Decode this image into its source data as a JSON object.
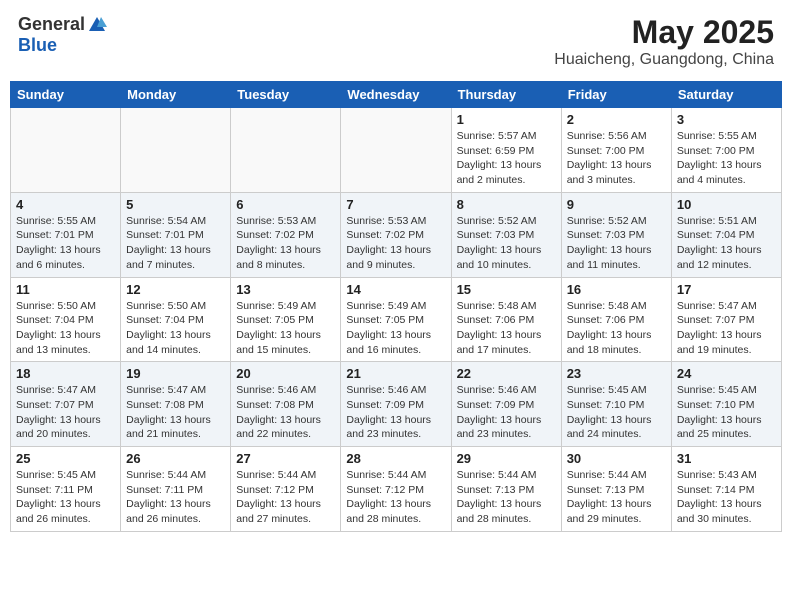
{
  "header": {
    "logo_general": "General",
    "logo_blue": "Blue",
    "month_title": "May 2025",
    "location": "Huaicheng, Guangdong, China"
  },
  "calendar": {
    "days_of_week": [
      "Sunday",
      "Monday",
      "Tuesday",
      "Wednesday",
      "Thursday",
      "Friday",
      "Saturday"
    ],
    "weeks": [
      [
        {
          "day": "",
          "content": ""
        },
        {
          "day": "",
          "content": ""
        },
        {
          "day": "",
          "content": ""
        },
        {
          "day": "",
          "content": ""
        },
        {
          "day": "1",
          "content": "Sunrise: 5:57 AM\nSunset: 6:59 PM\nDaylight: 13 hours and 2 minutes."
        },
        {
          "day": "2",
          "content": "Sunrise: 5:56 AM\nSunset: 7:00 PM\nDaylight: 13 hours and 3 minutes."
        },
        {
          "day": "3",
          "content": "Sunrise: 5:55 AM\nSunset: 7:00 PM\nDaylight: 13 hours and 4 minutes."
        }
      ],
      [
        {
          "day": "4",
          "content": "Sunrise: 5:55 AM\nSunset: 7:01 PM\nDaylight: 13 hours and 6 minutes."
        },
        {
          "day": "5",
          "content": "Sunrise: 5:54 AM\nSunset: 7:01 PM\nDaylight: 13 hours and 7 minutes."
        },
        {
          "day": "6",
          "content": "Sunrise: 5:53 AM\nSunset: 7:02 PM\nDaylight: 13 hours and 8 minutes."
        },
        {
          "day": "7",
          "content": "Sunrise: 5:53 AM\nSunset: 7:02 PM\nDaylight: 13 hours and 9 minutes."
        },
        {
          "day": "8",
          "content": "Sunrise: 5:52 AM\nSunset: 7:03 PM\nDaylight: 13 hours and 10 minutes."
        },
        {
          "day": "9",
          "content": "Sunrise: 5:52 AM\nSunset: 7:03 PM\nDaylight: 13 hours and 11 minutes."
        },
        {
          "day": "10",
          "content": "Sunrise: 5:51 AM\nSunset: 7:04 PM\nDaylight: 13 hours and 12 minutes."
        }
      ],
      [
        {
          "day": "11",
          "content": "Sunrise: 5:50 AM\nSunset: 7:04 PM\nDaylight: 13 hours and 13 minutes."
        },
        {
          "day": "12",
          "content": "Sunrise: 5:50 AM\nSunset: 7:04 PM\nDaylight: 13 hours and 14 minutes."
        },
        {
          "day": "13",
          "content": "Sunrise: 5:49 AM\nSunset: 7:05 PM\nDaylight: 13 hours and 15 minutes."
        },
        {
          "day": "14",
          "content": "Sunrise: 5:49 AM\nSunset: 7:05 PM\nDaylight: 13 hours and 16 minutes."
        },
        {
          "day": "15",
          "content": "Sunrise: 5:48 AM\nSunset: 7:06 PM\nDaylight: 13 hours and 17 minutes."
        },
        {
          "day": "16",
          "content": "Sunrise: 5:48 AM\nSunset: 7:06 PM\nDaylight: 13 hours and 18 minutes."
        },
        {
          "day": "17",
          "content": "Sunrise: 5:47 AM\nSunset: 7:07 PM\nDaylight: 13 hours and 19 minutes."
        }
      ],
      [
        {
          "day": "18",
          "content": "Sunrise: 5:47 AM\nSunset: 7:07 PM\nDaylight: 13 hours and 20 minutes."
        },
        {
          "day": "19",
          "content": "Sunrise: 5:47 AM\nSunset: 7:08 PM\nDaylight: 13 hours and 21 minutes."
        },
        {
          "day": "20",
          "content": "Sunrise: 5:46 AM\nSunset: 7:08 PM\nDaylight: 13 hours and 22 minutes."
        },
        {
          "day": "21",
          "content": "Sunrise: 5:46 AM\nSunset: 7:09 PM\nDaylight: 13 hours and 23 minutes."
        },
        {
          "day": "22",
          "content": "Sunrise: 5:46 AM\nSunset: 7:09 PM\nDaylight: 13 hours and 23 minutes."
        },
        {
          "day": "23",
          "content": "Sunrise: 5:45 AM\nSunset: 7:10 PM\nDaylight: 13 hours and 24 minutes."
        },
        {
          "day": "24",
          "content": "Sunrise: 5:45 AM\nSunset: 7:10 PM\nDaylight: 13 hours and 25 minutes."
        }
      ],
      [
        {
          "day": "25",
          "content": "Sunrise: 5:45 AM\nSunset: 7:11 PM\nDaylight: 13 hours and 26 minutes."
        },
        {
          "day": "26",
          "content": "Sunrise: 5:44 AM\nSunset: 7:11 PM\nDaylight: 13 hours and 26 minutes."
        },
        {
          "day": "27",
          "content": "Sunrise: 5:44 AM\nSunset: 7:12 PM\nDaylight: 13 hours and 27 minutes."
        },
        {
          "day": "28",
          "content": "Sunrise: 5:44 AM\nSunset: 7:12 PM\nDaylight: 13 hours and 28 minutes."
        },
        {
          "day": "29",
          "content": "Sunrise: 5:44 AM\nSunset: 7:13 PM\nDaylight: 13 hours and 28 minutes."
        },
        {
          "day": "30",
          "content": "Sunrise: 5:44 AM\nSunset: 7:13 PM\nDaylight: 13 hours and 29 minutes."
        },
        {
          "day": "31",
          "content": "Sunrise: 5:43 AM\nSunset: 7:14 PM\nDaylight: 13 hours and 30 minutes."
        }
      ]
    ]
  }
}
